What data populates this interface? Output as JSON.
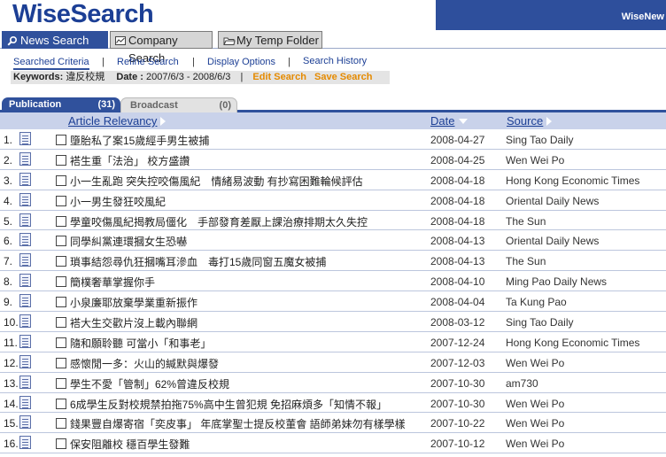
{
  "header": {
    "logo": "WiseSearch",
    "right_text": "WiseNew"
  },
  "tabs": [
    {
      "label": "News Search",
      "icon": "magnifier-icon"
    },
    {
      "label": "Company Search",
      "icon": "chart-icon"
    },
    {
      "label": "My Temp Folder",
      "icon": "folder-icon"
    }
  ],
  "subnav": {
    "items": [
      "Searched Criteria",
      "Refine Search",
      "Display Options",
      "Search History"
    ],
    "separator": "|"
  },
  "criteria": {
    "keywords_label": "Keywords:",
    "keywords_value": "違反校規",
    "date_label": "Date :",
    "date_value": "2007/6/3 - 2008/6/3",
    "separator": "|",
    "edit_search": "Edit Search",
    "save_search": "Save Search"
  },
  "subtabs": [
    {
      "label": "Publication",
      "count": "(31)"
    },
    {
      "label": "Broadcast",
      "count": "(0)"
    }
  ],
  "columns": {
    "relevancy": "Article Relevancy",
    "date": "Date",
    "source": "Source"
  },
  "rows": [
    {
      "num": "1.",
      "title": "墮胎私了案15歲經手男生被捕",
      "date": "2008-04-27",
      "source": "Sing Tao Daily"
    },
    {
      "num": "2.",
      "title": "褡生重「法治」 校方盛讚",
      "date": "2008-04-25",
      "source": "Wen Wei Po"
    },
    {
      "num": "3.",
      "title": "小一生亂跑 突失控咬傷風紀　情緒易波動 有抄寫困難輪候評估",
      "date": "2008-04-18",
      "source": "Hong Kong Economic Times"
    },
    {
      "num": "4.",
      "title": "小一男生發狂咬風紀",
      "date": "2008-04-18",
      "source": "Oriental Daily News"
    },
    {
      "num": "5.",
      "title": "學童咬傷風紀揭教局僵化　手部發育差厭上課治療排期太久失控",
      "date": "2008-04-18",
      "source": "The Sun"
    },
    {
      "num": "6.",
      "title": "同學糾黨連環摑女生恐嚇",
      "date": "2008-04-13",
      "source": "Oriental Daily News"
    },
    {
      "num": "7.",
      "title": "瑣事結怨尋仇狂摑嘴耳滲血　毒打15歲同窗五魔女被捕",
      "date": "2008-04-13",
      "source": "The Sun"
    },
    {
      "num": "8.",
      "title": "簡樸奢華掌握你手",
      "date": "2008-04-10",
      "source": "Ming Pao Daily News"
    },
    {
      "num": "9.",
      "title": "小泉廉耶放棄學業重新振作",
      "date": "2008-04-04",
      "source": "Ta Kung Pao"
    },
    {
      "num": "10.",
      "title": "褡大生交歡片沒上載內聯網",
      "date": "2008-03-12",
      "source": "Sing Tao Daily"
    },
    {
      "num": "11.",
      "title": "隨和願聆聽 可當小「和事老」",
      "date": "2007-12-24",
      "source": "Hong Kong Economic Times"
    },
    {
      "num": "12.",
      "title": "感懷閒一多：火山的緘默與爆發",
      "date": "2007-12-03",
      "source": "Wen Wei Po"
    },
    {
      "num": "13.",
      "title": "學生不愛「管制」62%曾違反校規",
      "date": "2007-10-30",
      "source": "am730"
    },
    {
      "num": "14.",
      "title": "6成學生反對校規禁拍拖75%高中生曾犯規 免招麻煩多「知情不報」",
      "date": "2007-10-30",
      "source": "Wen Wei Po"
    },
    {
      "num": "15.",
      "title": "錢果豐自爆寄宿「奕皮事」 年底掌聖士提反校董會 語師弟妹勿有樣學樣",
      "date": "2007-10-22",
      "source": "Wen Wei Po"
    },
    {
      "num": "16.",
      "title": "保安阻離校 穩百學生發難",
      "date": "2007-10-12",
      "source": "Wen Wei Po"
    }
  ],
  "colors": {
    "brand": "#1c3f95",
    "tab_active": "#30519c",
    "header_band": "#c9d2ea",
    "accent": "#e58a00"
  }
}
